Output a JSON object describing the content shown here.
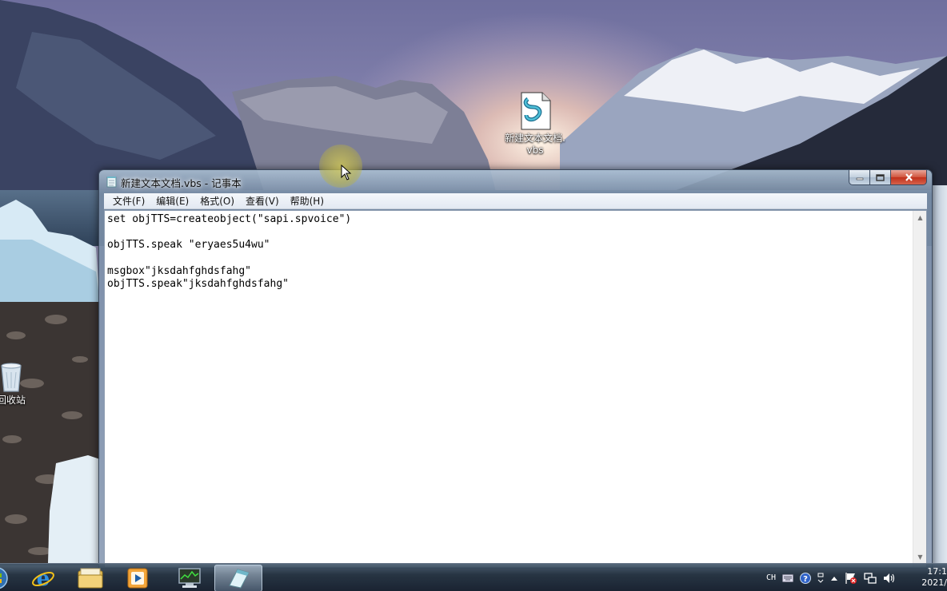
{
  "desktop": {
    "icons": [
      {
        "label_line1": "新建文本文档.",
        "label_line2": "vbs",
        "icon": "vbs-script-icon"
      },
      {
        "label": "回收站",
        "icon": "recycle-bin-icon"
      }
    ]
  },
  "window": {
    "title": "新建文本文档.vbs - 记事本",
    "menu": [
      "文件(F)",
      "编辑(E)",
      "格式(O)",
      "查看(V)",
      "帮助(H)"
    ],
    "controls": {
      "minimize": "minimize-icon",
      "maximize": "maximize-icon",
      "close": "close-icon"
    },
    "content": "set objTTS=createobject(\"sapi.spvoice\")\n\nobjTTS.speak \"eryaes5u4wu\"\n\nmsgbox\"jksdahfghdsfahg\"\nobjTTS.speak\"jksdahfghdsfahg\""
  },
  "taskbar": {
    "buttons": [
      "start-orb-icon",
      "internet-explorer-icon",
      "file-explorer-icon",
      "media-player-icon",
      "task-manager-icon",
      "notepad-icon"
    ],
    "tray": {
      "language": "CH",
      "icons": [
        "keyboard-icon",
        "help-icon",
        "ime-settings-icon",
        "show-hidden-icons-icon",
        "action-center-flag-icon",
        "network-icon",
        "volume-icon"
      ]
    },
    "clock": {
      "time": "17:1",
      "date": "2021/"
    }
  },
  "colors": {
    "close_button": "#c7361f",
    "taskbar": "#1c2a3a",
    "editor_background": "#ffffff"
  }
}
